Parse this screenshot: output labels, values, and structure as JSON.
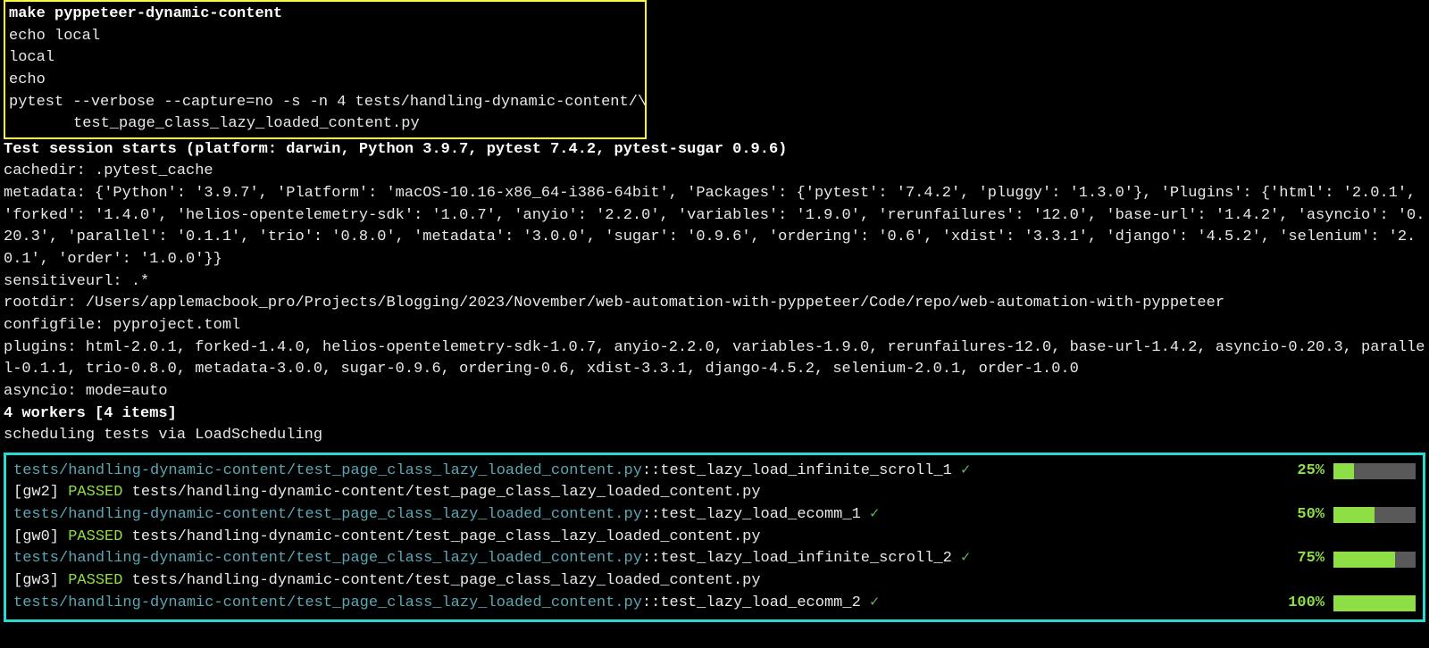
{
  "cmdbox": {
    "cmd": "make pyppeteer-dynamic-content",
    "l1": "echo local",
    "l2": "local",
    "l3": "echo",
    "l4": "",
    "l5": "pytest --verbose --capture=no -s -n 4 tests/handling-dynamic-content/\\",
    "l6": "test_page_class_lazy_loaded_content.py"
  },
  "session": {
    "starts": "Test session starts (platform: darwin, Python 3.9.7, pytest 7.4.2, pytest-sugar 0.9.6)",
    "cachedir": "cachedir: .pytest_cache",
    "metadata": "metadata: {'Python': '3.9.7', 'Platform': 'macOS-10.16-x86_64-i386-64bit', 'Packages': {'pytest': '7.4.2', 'pluggy': '1.3.0'}, 'Plugins': {'html': '2.0.1', 'forked': '1.4.0', 'helios-opentelemetry-sdk': '1.0.7', 'anyio': '2.2.0', 'variables': '1.9.0', 'rerunfailures': '12.0', 'base-url': '1.4.2', 'asyncio': '0.20.3', 'parallel': '0.1.1', 'trio': '0.8.0', 'metadata': '3.0.0', 'sugar': '0.9.6', 'ordering': '0.6', 'xdist': '3.3.1', 'django': '4.5.2', 'selenium': '2.0.1', 'order': '1.0.0'}}",
    "sensitiveurl": "sensitiveurl: .*",
    "rootdir": "rootdir: /Users/applemacbook_pro/Projects/Blogging/2023/November/web-automation-with-pyppeteer/Code/repo/web-automation-with-pyppeteer",
    "configfile": "configfile: pyproject.toml",
    "plugins": "plugins: html-2.0.1, forked-1.4.0, helios-opentelemetry-sdk-1.0.7, anyio-2.2.0, variables-1.9.0, rerunfailures-12.0, base-url-1.4.2, asyncio-0.20.3, parallel-0.1.1, trio-0.8.0, metadata-3.0.0, sugar-0.9.6, ordering-0.6, xdist-3.3.1, django-4.5.2, selenium-2.0.1, order-1.0.0",
    "asyncio": "asyncio: mode=auto",
    "workers": "4 workers [4 items]",
    "scheduling": "scheduling tests via LoadScheduling"
  },
  "results": {
    "file_path": "tests/handling-dynamic-content/test_page_class_lazy_loaded_content.py",
    "rows": [
      {
        "sep": "::",
        "test": "test_lazy_load_infinite_scroll_1",
        "check": "✓",
        "pct": "25%",
        "fill": 25
      },
      {
        "worker": "[gw2]",
        "status": "PASSED"
      },
      {
        "sep": "::",
        "test": "test_lazy_load_ecomm_1",
        "check": "✓",
        "pct": "50%",
        "fill": 50
      },
      {
        "worker": "[gw0]",
        "status": "PASSED"
      },
      {
        "sep": "::",
        "test": "test_lazy_load_infinite_scroll_2",
        "check": "✓",
        "pct": "75%",
        "fill": 75
      },
      {
        "worker": "[gw3]",
        "status": "PASSED"
      },
      {
        "sep": "::",
        "test": "test_lazy_load_ecomm_2",
        "check": "✓",
        "pct": "100%",
        "fill": 100
      }
    ]
  }
}
